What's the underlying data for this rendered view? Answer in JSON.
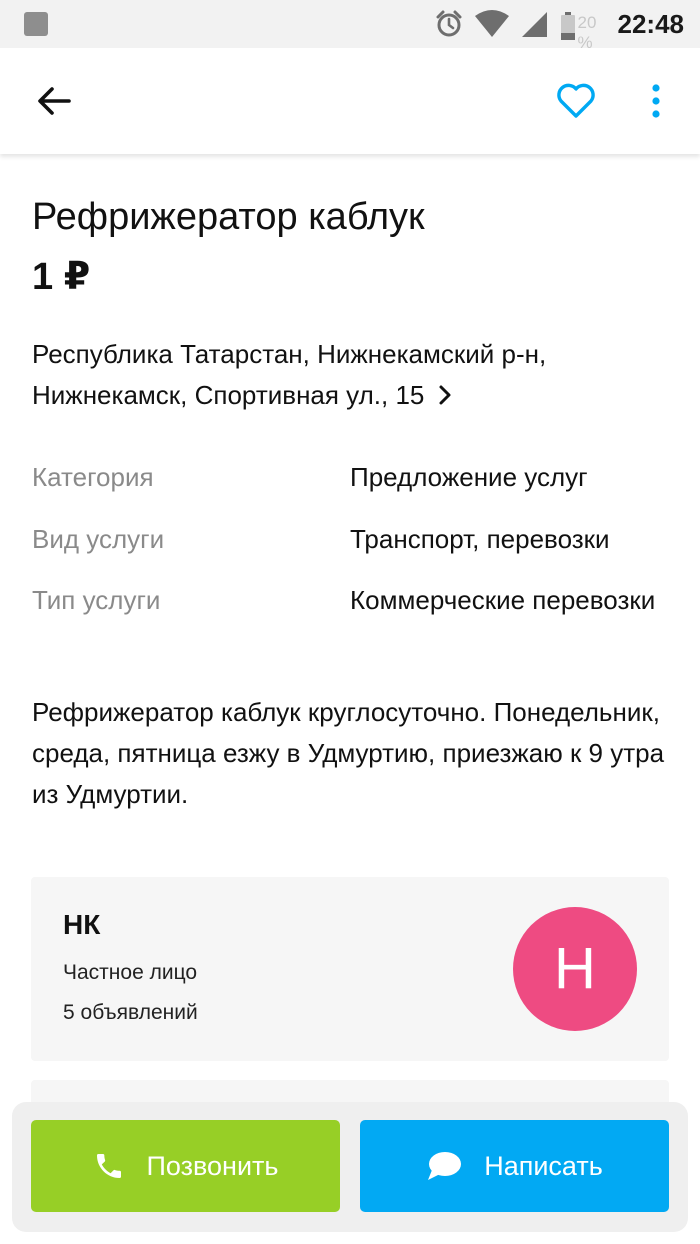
{
  "status_bar": {
    "battery_percent": "20 %",
    "time": "22:48",
    "icons": [
      "notification-square-icon",
      "alarm-icon",
      "wifi-icon",
      "signal-icon",
      "battery-icon"
    ]
  },
  "toolbar": {
    "icons": [
      "back-arrow-icon",
      "heart-icon",
      "more-vertical-icon"
    ],
    "accent_color": "#00a9f3"
  },
  "listing": {
    "title": "Рефрижератор каблук",
    "price": "1 ₽",
    "address_line1": "Республика Татарстан, Нижнекамский р-н,",
    "address_line2": "Нижнекамск, Спортивная ул., 15",
    "params": [
      {
        "label": "Категория",
        "value": "Предложение услуг"
      },
      {
        "label": "Вид услуги",
        "value": "Транспорт, перевозки"
      },
      {
        "label": "Тип услуги",
        "value": "Коммерческие перевозки"
      }
    ],
    "description": "Рефрижератор каблук круглосуточно. Понедельник, среда, пятница езжу в Удмуртию, приезжаю к 9 утра из Удмуртии."
  },
  "seller": {
    "name": "НК",
    "type": "Частное лицо",
    "ads_count": "5 объявлений",
    "avatar_letter": "Н",
    "avatar_color": "#ee4b82"
  },
  "actions": {
    "call_label": "Позвонить",
    "call_color": "#97cf26",
    "message_label": "Написать",
    "message_color": "#02a9f3"
  }
}
